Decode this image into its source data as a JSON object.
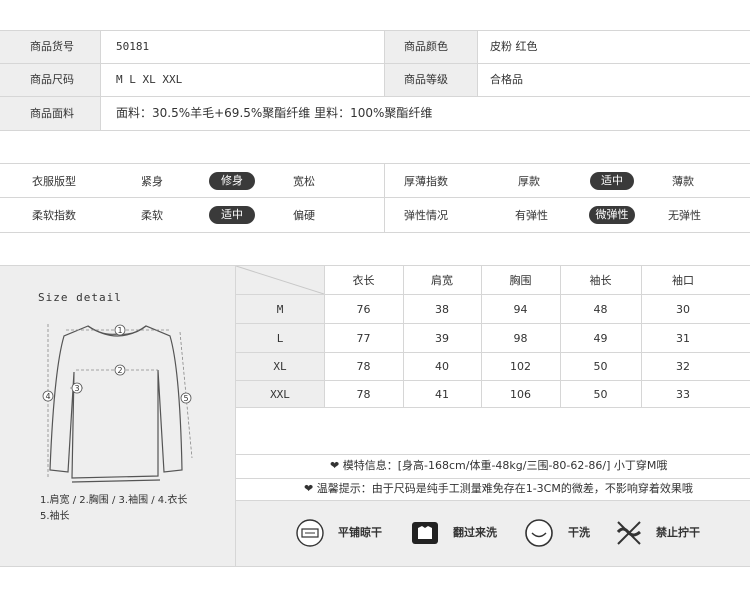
{
  "product_info": {
    "rows": [
      {
        "label1": "商品货号",
        "value1": "50181",
        "label2": "商品颜色",
        "value2": "皮粉 红色"
      },
      {
        "label1": "商品尺码",
        "value1": "M L XL XXL",
        "label2": "商品等级",
        "value2": "合格品"
      }
    ],
    "fabric_label": "商品面料",
    "fabric_value": "面料：30.5%羊毛+69.5%聚酯纤维  里料：100%聚酯纤维"
  },
  "indices": {
    "rows": [
      {
        "label1": "衣服版型",
        "opts1": [
          "紧身",
          "修身",
          "宽松"
        ],
        "sel1": "修身",
        "label2": "厚薄指数",
        "opts2": [
          "厚款",
          "适中",
          "薄款"
        ],
        "sel2": "适中"
      },
      {
        "label1": "柔软指数",
        "opts1": [
          "柔软",
          "适中",
          "偏硬"
        ],
        "sel1": "适中",
        "label2": "弹性情况",
        "opts2": [
          "有弹性",
          "微弹性",
          "无弹性"
        ],
        "sel2": "微弹性"
      }
    ]
  },
  "size_detail": {
    "title": "Size detail",
    "legend_line1": "1.肩宽 / 2.胸围 / 3.袖围 / 4.衣长",
    "legend_line2": "5.袖长",
    "markers": [
      "1",
      "2",
      "3",
      "4",
      "5"
    ]
  },
  "size_table": {
    "headers": [
      "衣长",
      "肩宽",
      "胸围",
      "袖长",
      "袖口"
    ],
    "rows": [
      {
        "size": "M",
        "values": [
          "76",
          "38",
          "94",
          "48",
          "30"
        ]
      },
      {
        "size": "L",
        "values": [
          "77",
          "39",
          "98",
          "49",
          "31"
        ]
      },
      {
        "size": "XL",
        "values": [
          "78",
          "40",
          "102",
          "50",
          "32"
        ]
      },
      {
        "size": "XXL",
        "values": [
          "78",
          "41",
          "106",
          "50",
          "33"
        ]
      }
    ]
  },
  "model_info": "❤ 模特信息：[身高-168cm/体重-48kg/三围-80-62-86/]   小丁穿M哦",
  "reminder": "❤ 温馨提示：由于尺码是纯手工测量难免存在1-3CM的微差，不影响穿着效果哦",
  "care": [
    {
      "icon": "flat-dry-icon",
      "label": "平铺晾干"
    },
    {
      "icon": "inside-out-icon",
      "label": "翻过来洗"
    },
    {
      "icon": "dry-clean-icon",
      "label": "干洗"
    },
    {
      "icon": "no-wring-icon",
      "label": "禁止拧干"
    }
  ],
  "colors": {
    "gray_bg": "#eeeeee",
    "line": "#d6d6d6",
    "pill": "#3a3a3a"
  }
}
